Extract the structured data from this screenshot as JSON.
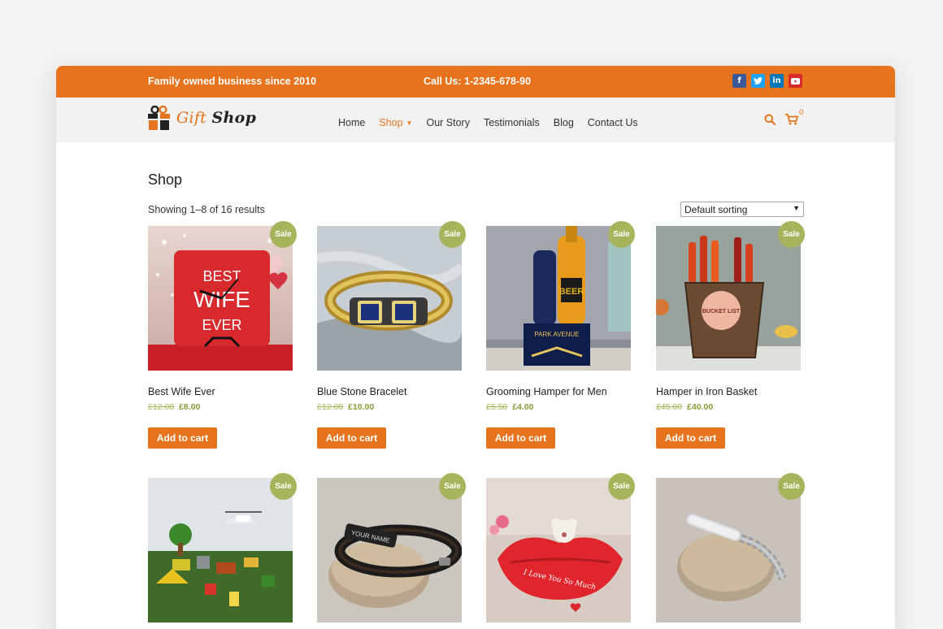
{
  "topbar": {
    "tagline": "Family owned business since 2010",
    "phone": "Call Us: 1-2345-678-90",
    "social": [
      {
        "icon": "facebook-icon",
        "glyph": "f"
      },
      {
        "icon": "twitter-icon",
        "glyph": "t"
      },
      {
        "icon": "linkedin-icon",
        "glyph": "in"
      },
      {
        "icon": "youtube-icon",
        "glyph": "▶"
      }
    ]
  },
  "header": {
    "logo_part1": "Gift",
    "logo_part2": "Shop",
    "nav": [
      "Home",
      "Shop",
      "Our Story",
      "Testimonials",
      "Blog",
      "Contact Us"
    ],
    "active_nav": "Shop",
    "cart_count": "0"
  },
  "main": {
    "title": "Shop",
    "results": "Showing 1–8 of 16 results",
    "sort_value": "Default sorting"
  },
  "sale_badge": "Sale",
  "add_to_cart": "Add to cart",
  "products": [
    {
      "name": "Best Wife Ever",
      "old_price": "£12.00",
      "price": "£8.00",
      "clock_text": [
        "BEST",
        "WIFE",
        "EVER"
      ]
    },
    {
      "name": "Blue Stone Bracelet",
      "old_price": "£12.00",
      "price": "£10.00"
    },
    {
      "name": "Grooming Hamper for Men",
      "old_price": "£5.50",
      "price": "£4.00",
      "box_text": "PARK AVENUE",
      "bottle_text": "BEER"
    },
    {
      "name": "Hamper in Iron Basket",
      "old_price": "£45.00",
      "price": "£40.00",
      "tag_text": "BUCKET LIST"
    },
    {
      "name": "",
      "old_price": "",
      "price": ""
    },
    {
      "name": "",
      "old_price": "",
      "price": "",
      "band_text": "YOUR NAME"
    },
    {
      "name": "",
      "old_price": "",
      "price": "",
      "lips_text": "I Love You So Much"
    },
    {
      "name": "",
      "old_price": "",
      "price": ""
    }
  ],
  "colors": {
    "accent": "#e8731d",
    "sale_badge": "#a8b45c",
    "facebook": "#3b5998",
    "twitter": "#1da1f2",
    "linkedin": "#0077b5",
    "youtube": "#d92b2b"
  }
}
